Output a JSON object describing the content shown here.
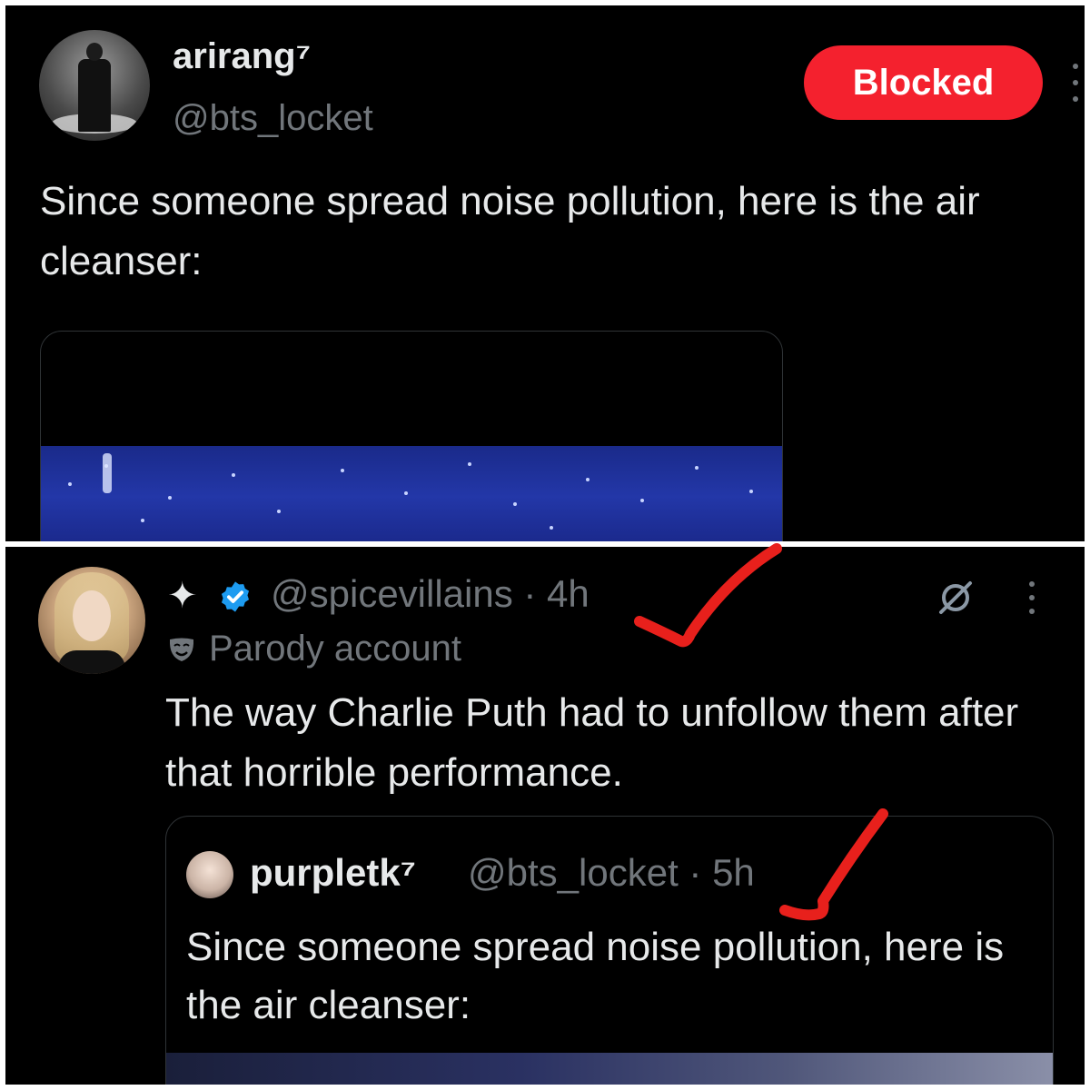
{
  "top_tweet": {
    "display_name": "arirang⁷",
    "handle": "@bts_locket",
    "block_button_label": "Blocked",
    "text": "Since someone spread noise pollution, here is the air cleanser:",
    "avatar_icon": "concert-figure-avatar",
    "more_icon": "more-vertical-icon"
  },
  "bottom_tweet": {
    "badge_icon": "sparkle-icon",
    "verified_icon": "verified-badge-icon",
    "handle_line": "@spicevillains · 4h",
    "parody_label": "Parody account",
    "parody_icon": "mask-icon",
    "grok_icon": "grok-icon",
    "more_icon": "more-vertical-icon",
    "text": "The way Charlie Puth had to unfollow them after that horrible performance.",
    "quote": {
      "display_name": "purpletk⁷",
      "handle_line": "@bts_locket · 5h",
      "text": "Since someone spread noise pollution, here is the air cleanser:"
    }
  },
  "colors": {
    "background": "#000000",
    "text_primary": "#e7e9ea",
    "text_secondary": "#71767b",
    "blocked_red": "#f4212e",
    "verified_blue": "#1d9bf0",
    "annotation_red": "#e8201c"
  }
}
